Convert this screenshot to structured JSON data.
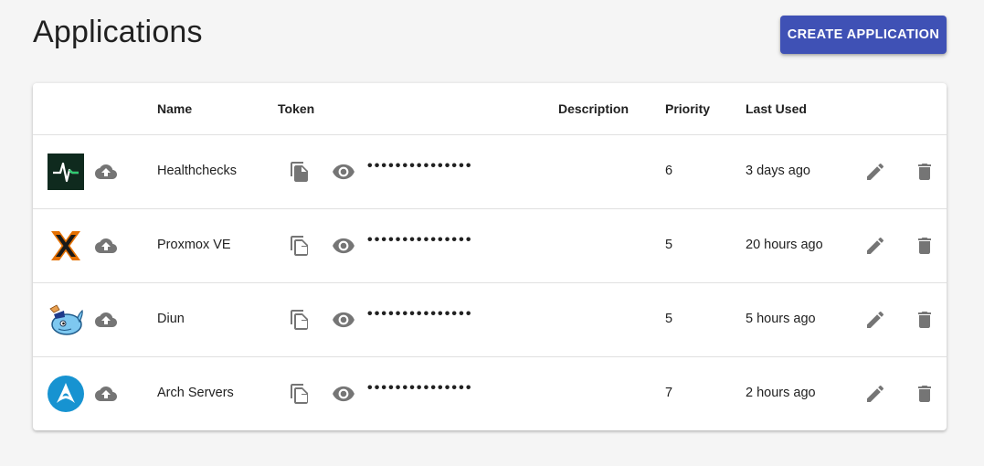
{
  "page": {
    "title": "Applications",
    "create_button": "CREATE APPLICATION"
  },
  "table": {
    "columns": [
      "",
      "Name",
      "Token",
      "Description",
      "Priority",
      "Last Used"
    ],
    "rows": [
      {
        "icon": "healthchecks-logo",
        "name": "Healthchecks",
        "token": "•••••••••••••••",
        "description": "",
        "priority": "6",
        "last_used": "3 days ago"
      },
      {
        "icon": "proxmox-logo",
        "name": "Proxmox VE",
        "token": "•••••••••••••••",
        "description": "",
        "priority": "5",
        "last_used": "20 hours ago"
      },
      {
        "icon": "diun-logo",
        "name": "Diun",
        "token": "•••••••••••••••",
        "description": "",
        "priority": "5",
        "last_used": "5 hours ago"
      },
      {
        "icon": "arch-linux-logo",
        "name": "Arch Servers",
        "token": "•••••••••••••••",
        "description": "",
        "priority": "7",
        "last_used": "2 hours ago"
      }
    ]
  },
  "colors": {
    "accent": "#3f51b5",
    "icon_grey": "#757575",
    "background": "#f5f5f5"
  }
}
